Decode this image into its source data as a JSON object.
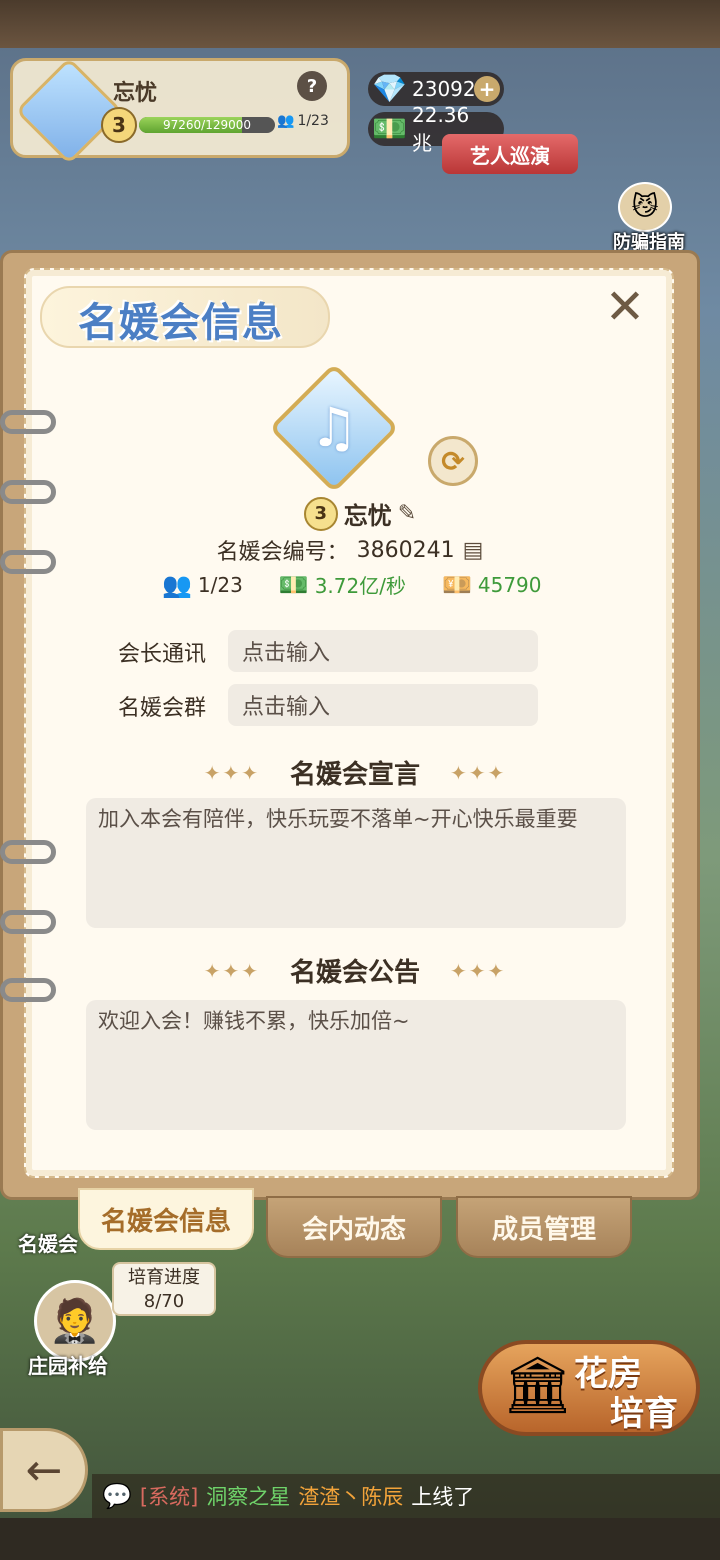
{
  "hud": {
    "guild_name": "忘忧",
    "level": "3",
    "xp_text": "97260/129000",
    "xp_fraction": 0.754,
    "members": "1/23",
    "help": "?",
    "gems": "23092",
    "cash": "22.36兆",
    "tour_button": "艺人巡演",
    "anti_fraud_label": "防骗指南"
  },
  "panel": {
    "title": "名媛会信息",
    "close": "✕",
    "guild_name": "忘忧",
    "level": "3",
    "id_label": "名媛会编号：",
    "id_value": "3860241",
    "members": "1/23",
    "income": "3.72亿/秒",
    "cash": "45790",
    "fields": [
      {
        "label": "会长通讯",
        "placeholder": "点击输入"
      },
      {
        "label": "名媛会群",
        "placeholder": "点击输入"
      }
    ],
    "declaration": {
      "title": "名媛会宣言",
      "text": "加入本会有陪伴，快乐玩耍不落单~开心快乐最重要"
    },
    "notice": {
      "title": "名媛会公告",
      "text": "欢迎入会！赚钱不累，快乐加倍~"
    },
    "sparkle_left": "✦✦✦",
    "sparkle_right": "✦✦✦"
  },
  "tabs": [
    {
      "label": "名媛会信息",
      "active": true
    },
    {
      "label": "会内动态",
      "active": false
    },
    {
      "label": "成员管理",
      "active": false
    }
  ],
  "bottom": {
    "estate_label": "名媛会",
    "progress_label": "培育进度",
    "progress_value": "8/70",
    "estate_gift": "庄园补给",
    "flower_line1": "花房",
    "flower_line2": "培育",
    "back": "←"
  },
  "chat": {
    "system": "[系统]",
    "name1": "洞察之星",
    "name2": "渣渣丶陈辰",
    "message": "上线了"
  },
  "icons": {
    "gem": "gem-icon",
    "cash": "cash-icon",
    "members": "members-icon",
    "refresh": "refresh-icon",
    "edit": "edit-icon",
    "copy": "copy-icon",
    "chat": "chat-icon"
  },
  "colors": {
    "title_blue": "#4c7fc4",
    "income_green": "#3e9a3a",
    "tab_active_text": "#a56d2a",
    "tour_red": "#c94343"
  }
}
